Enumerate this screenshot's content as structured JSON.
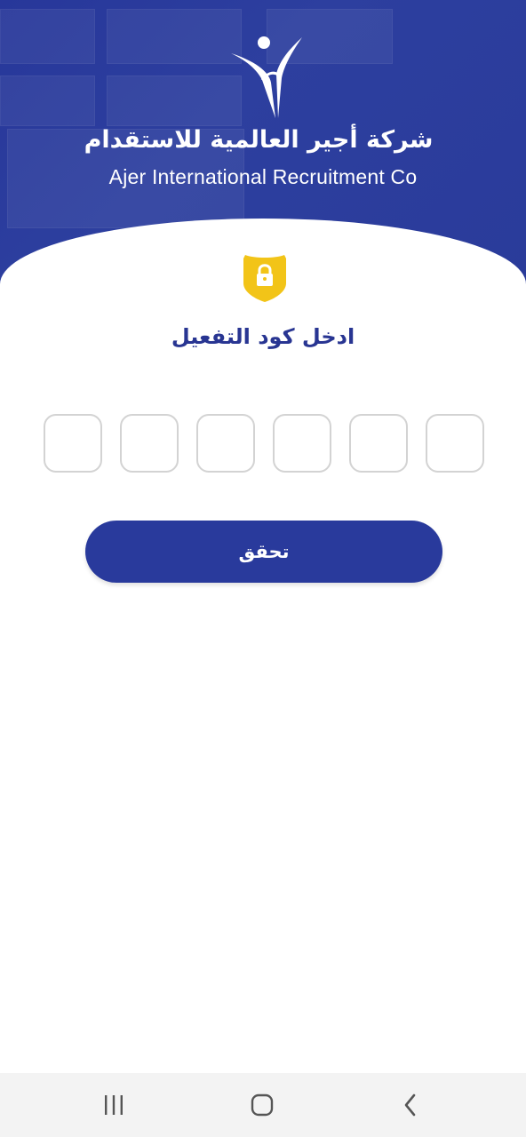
{
  "header": {
    "company_name_ar": "شركة أجير العالمية للاستقدام",
    "company_name_en": "Ajer International Recruitment Co",
    "logo_icon": "ajer-logo",
    "bg_color": "#2a3b9c"
  },
  "verification": {
    "icon": "lock-shield-icon",
    "icon_color": "#f0c419",
    "title": "ادخل كود التفعيل",
    "code_length": 6,
    "code_values": [
      "",
      "",
      "",
      "",
      "",
      ""
    ],
    "button_label": "تحقق",
    "accent_color": "#293a9c"
  },
  "navbar": {
    "items": [
      "recent-apps-icon",
      "home-icon",
      "back-icon"
    ]
  }
}
